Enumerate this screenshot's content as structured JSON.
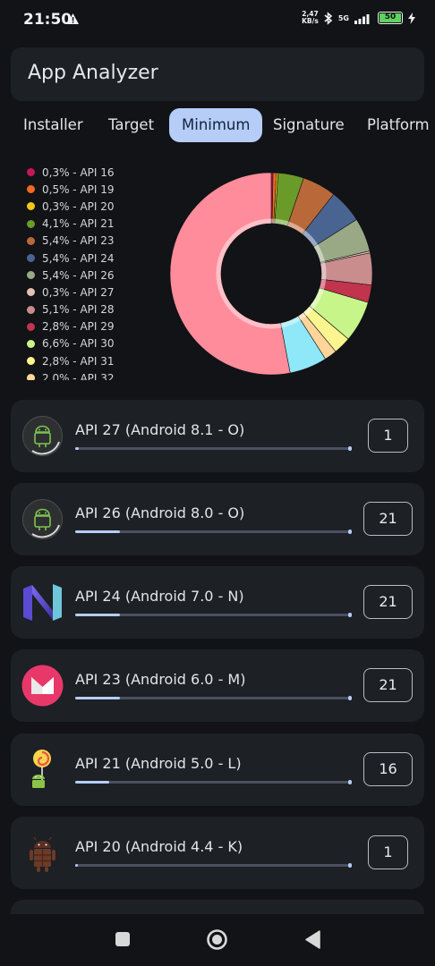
{
  "status": {
    "time": "21:50",
    "net_speed_value": "2,47",
    "net_speed_unit": "KB/s",
    "network": "5G",
    "battery": "50"
  },
  "app": {
    "title": "App Analyzer"
  },
  "tabs": [
    {
      "label": "Installer"
    },
    {
      "label": "Target"
    },
    {
      "label": "Minimum"
    },
    {
      "label": "Signature"
    },
    {
      "label": "Platform"
    }
  ],
  "chart_data": {
    "type": "pie",
    "legend_placement": "left",
    "slices": [
      {
        "label": "0,3% - API 16",
        "value": 0.3,
        "color": "#c2185b"
      },
      {
        "label": "0,5% - API 19",
        "value": 0.5,
        "color": "#f26a21"
      },
      {
        "label": "0,3% - API 20",
        "value": 0.3,
        "color": "#f5c518"
      },
      {
        "label": "4,1% - API 21",
        "value": 4.1,
        "color": "#6a9a2a"
      },
      {
        "label": "5,4% - API 23",
        "value": 5.4,
        "color": "#b9683a"
      },
      {
        "label": "5,4% - API 24",
        "value": 5.4,
        "color": "#4a6491"
      },
      {
        "label": "5,4% - API 26",
        "value": 5.4,
        "color": "#99a985"
      },
      {
        "label": "0,3% - API 27",
        "value": 0.3,
        "color": "#e5c1b4"
      },
      {
        "label": "5,1% - API 28",
        "value": 5.1,
        "color": "#c98d8d"
      },
      {
        "label": "2,8% - API 29",
        "value": 2.8,
        "color": "#c2334d"
      },
      {
        "label": "6,6% - API 30",
        "value": 6.6,
        "color": "#c8f58a"
      },
      {
        "label": "2,8% - API 31",
        "value": 2.8,
        "color": "#fbf58f"
      },
      {
        "label": "2,0% - API 32",
        "value": 2.0,
        "color": "#ffd59a"
      },
      {
        "label": "",
        "value": 6.0,
        "color": "#8ee8f8"
      },
      {
        "label": "",
        "value": 53.0,
        "color": "#ff8c9a"
      }
    ]
  },
  "cards": [
    {
      "label": "API 27 (Android 8.1 - O)",
      "count": "1",
      "progress": 0.004,
      "icon": "android-oreo-icon"
    },
    {
      "label": "API 26 (Android 8.0 - O)",
      "count": "21",
      "progress": 0.054,
      "icon": "android-oreo-icon"
    },
    {
      "label": "API 24 (Android 7.0 - N)",
      "count": "21",
      "progress": 0.054,
      "icon": "android-nougat-icon"
    },
    {
      "label": "API 23 (Android 6.0 - M)",
      "count": "21",
      "progress": 0.054,
      "icon": "android-marshmallow-icon"
    },
    {
      "label": "API 21 (Android 5.0 - L)",
      "count": "16",
      "progress": 0.041,
      "icon": "android-lollipop-icon"
    },
    {
      "label": "API 20 (Android 4.4 - K)",
      "count": "1",
      "progress": 0.003,
      "icon": "android-kitkat-icon"
    }
  ],
  "colors": {
    "accent": "#b6cdf7",
    "card": "#1d2024",
    "background": "#111316"
  }
}
